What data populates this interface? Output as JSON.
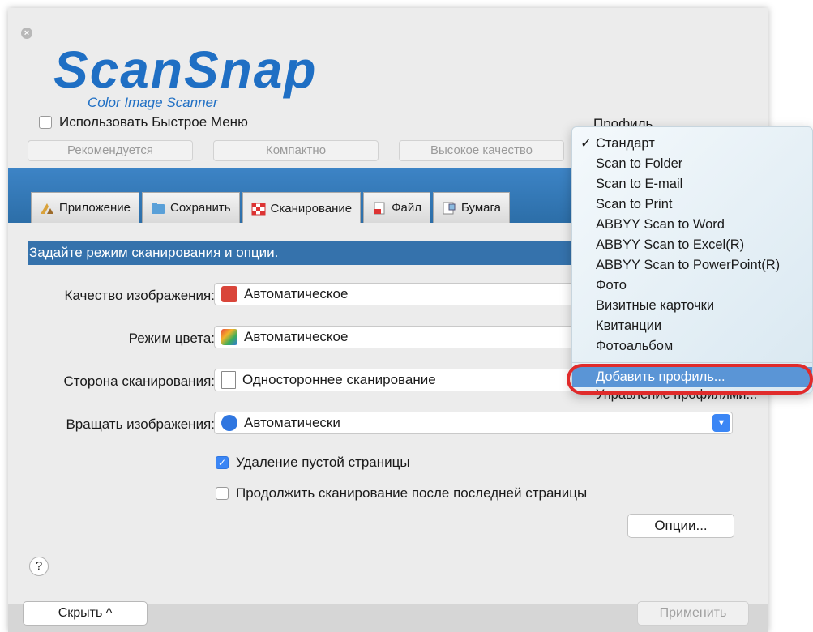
{
  "window": {
    "logo_title": "ScanSnap",
    "logo_subtitle": "Color Image Scanner"
  },
  "top": {
    "quick_menu_label": "Использовать Быстрое Меню",
    "profile_label": "Профиль",
    "presets": [
      "Рекомендуется",
      "Компактно",
      "Высокое качество"
    ]
  },
  "tabs": [
    {
      "label": "Приложение",
      "icon": "application-icon"
    },
    {
      "label": "Сохранить",
      "icon": "folder-icon"
    },
    {
      "label": "Сканирование",
      "icon": "scan-icon"
    },
    {
      "label": "Файл",
      "icon": "file-icon"
    },
    {
      "label": "Бумага",
      "icon": "paper-icon"
    }
  ],
  "scan": {
    "header": "Задайте режим сканирования и опции.",
    "fields": [
      {
        "label": "Качество изображения:",
        "value": "Автоматическое"
      },
      {
        "label": "Режим цвета:",
        "value": "Автоматическое"
      },
      {
        "label": "Сторона сканирования:",
        "value": "Одностороннее сканирование"
      },
      {
        "label": "Вращать изображения:",
        "value": "Автоматически"
      }
    ],
    "blank_page_removal": "Удаление пустой страницы",
    "continue_scanning": "Продолжить сканирование после последней страницы",
    "options_button": "Опции..."
  },
  "footer": {
    "help": "?",
    "hide_button": "Скрыть ^",
    "apply_button": "Применить"
  },
  "profile_menu": {
    "checkmark": "✓",
    "items": [
      "Стандарт",
      "Scan to Folder",
      "Scan to E-mail",
      "Scan to Print",
      "ABBYY Scan to Word",
      "ABBYY Scan to Excel(R)",
      "ABBYY Scan to PowerPoint(R)",
      "Фото",
      "Визитные карточки",
      "Квитанции",
      "Фотоальбом"
    ],
    "add_profile": "Добавить профиль...",
    "manage_profiles": "Управление профилями..."
  },
  "colors": {
    "accent": "#3b86f5",
    "band": "#3572ac",
    "highlight": "#5a95d6",
    "annotation": "#e02b2b"
  }
}
